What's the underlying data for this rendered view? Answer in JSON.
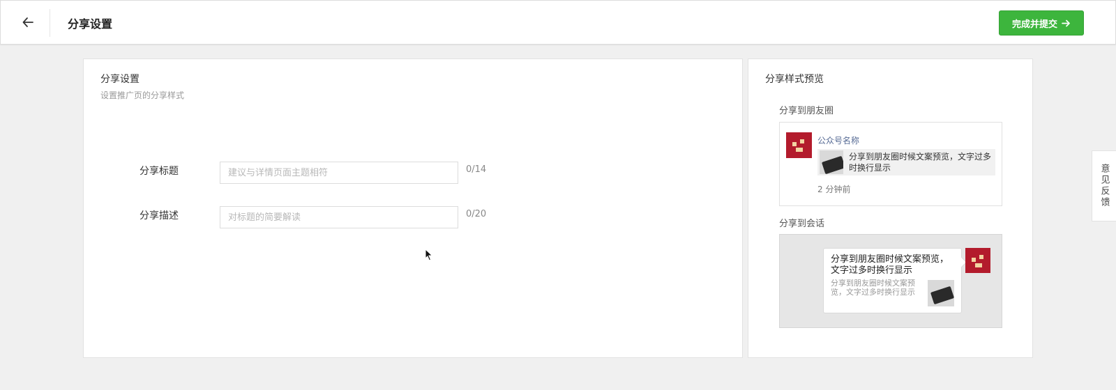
{
  "header": {
    "title": "分享设置",
    "back_icon": "arrow-left-icon",
    "submit_label": "完成并提交",
    "submit_icon": "arrow-right-icon",
    "accent_color": "#3db53d"
  },
  "settings": {
    "title": "分享设置",
    "description": "设置推广页的分享样式",
    "fields": [
      {
        "label": "分享标题",
        "value": "",
        "placeholder": "建议与详情页面主题相符",
        "counter": "0/14"
      },
      {
        "label": "分享描述",
        "value": "",
        "placeholder": "对标题的简要解读",
        "counter": "0/20"
      }
    ]
  },
  "preview": {
    "title": "分享样式预览",
    "moments": {
      "label": "分享到朋友圈",
      "account_name": "公众号名称",
      "link_text": "分享到朋友圈时候文案预览，文字过多时换行显示",
      "time": "2 分钟前"
    },
    "chat": {
      "label": "分享到会话",
      "title": "分享到朋友圈时候文案预览，文字过多时换行显示",
      "description": "分享到朋友圈时候文案预览，文字过多时换行显示"
    }
  },
  "feedback": {
    "label": "意见反馈"
  }
}
